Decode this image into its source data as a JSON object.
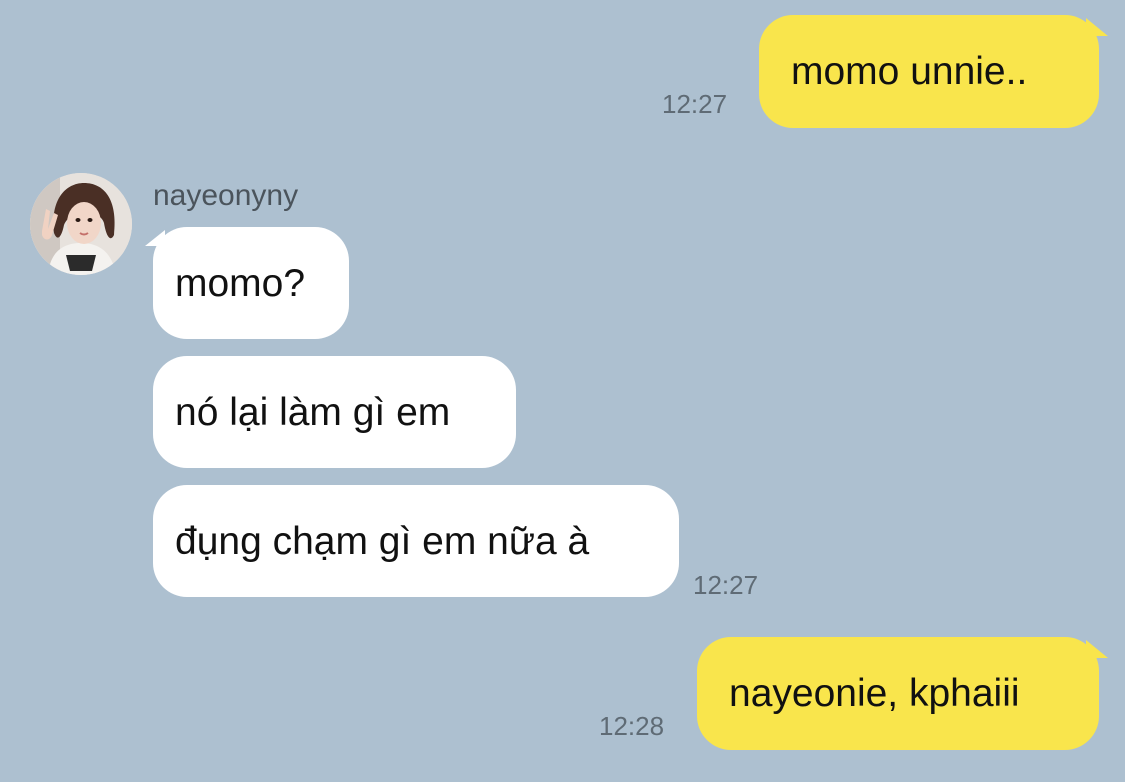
{
  "chat": {
    "messages": [
      {
        "side": "me",
        "text": "momo unnie..",
        "time": "12:27"
      },
      {
        "side": "them",
        "sender": "nayeonyny",
        "text": "momo?"
      },
      {
        "side": "them",
        "text": "nó lại làm gì em"
      },
      {
        "side": "them",
        "text": "đụng chạm gì em nữa à",
        "time": "12:27"
      },
      {
        "side": "me",
        "text": "nayeonie, kphaiii",
        "time": "12:28"
      }
    ]
  },
  "colors": {
    "background": "#adc0d0",
    "my_bubble": "#f9e54c",
    "their_bubble": "#ffffff",
    "time_text": "#5f6b75"
  },
  "icons": {
    "avatar": "profile-photo"
  }
}
